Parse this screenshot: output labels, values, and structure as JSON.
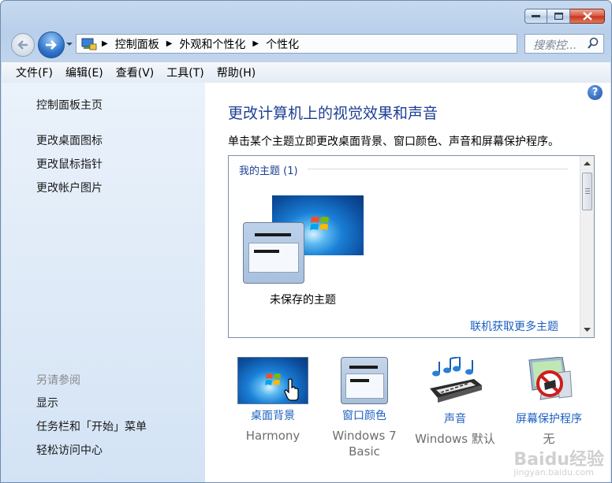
{
  "window": {
    "caption": {
      "min": "minimize",
      "max": "maximize",
      "close": "close"
    }
  },
  "address": {
    "segments": [
      "控制面板",
      "外观和个性化",
      "个性化"
    ]
  },
  "search": {
    "placeholder": "搜索控..."
  },
  "menu": [
    "文件(F)",
    "编辑(E)",
    "查看(V)",
    "工具(T)",
    "帮助(H)"
  ],
  "left": {
    "home": "控制面板主页",
    "links": [
      "更改桌面图标",
      "更改鼠标指针",
      "更改帐户图片"
    ],
    "see_also": "另请参阅",
    "also_links": [
      "显示",
      "任务栏和「开始」菜单",
      "轻松访问中心"
    ]
  },
  "main": {
    "help": "?",
    "title": "更改计算机上的视觉效果和声音",
    "desc": "单击某个主题立即更改桌面背景、窗口颜色、声音和屏幕保护程序。",
    "my_themes": "我的主题 (1)",
    "unsaved_theme": "未保存的主题",
    "get_more": "联机获取更多主题"
  },
  "bottom": [
    {
      "label": "桌面背景",
      "sub": "Harmony"
    },
    {
      "label": "窗口颜色",
      "sub": "Windows 7 Basic"
    },
    {
      "label": "声音",
      "sub": "Windows 默认"
    },
    {
      "label": "屏幕保护程序",
      "sub": "无"
    }
  ],
  "watermark": {
    "main": "Baidu经验",
    "sub": "jingyan.baidu.com"
  },
  "colors": {
    "link": "#1c5fc0",
    "title": "#1c3f95",
    "close": "#c8311a"
  }
}
